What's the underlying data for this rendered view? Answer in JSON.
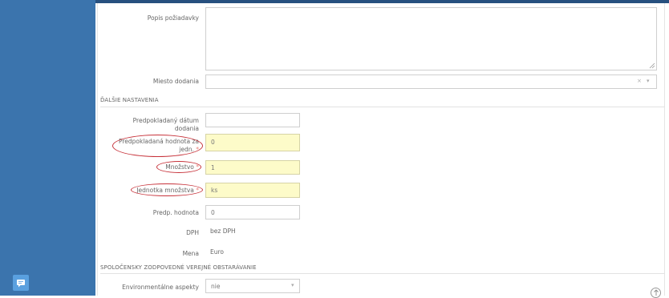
{
  "form": {
    "popis_label": "Popis požiadavky",
    "miesto_label": "Miesto dodania",
    "miesto_clear": "×",
    "miesto_arrow": "▾",
    "section_dalsie": "ĎALŠIE NASTAVENIA",
    "datum_label": "Predpokladaný dátum dodania",
    "hodnota_jedn_label_1": "Predpokladaná hodnota za",
    "hodnota_jedn_label_2": "jedn.",
    "hodnota_jedn_value": "0",
    "mnozstvo_label": "Množstvo",
    "mnozstvo_value": "1",
    "jednotka_label": "Jednotka množstva",
    "jednotka_value": "ks",
    "predp_hodnota_label": "Predp. hodnota",
    "predp_hodnota_value": "0",
    "dph_label": "DPH",
    "dph_value": "bez DPH",
    "mena_label": "Mena",
    "mena_value": "Euro",
    "required_mark": "*",
    "section_spolocensky": "SPOLOČENSKY ZODPOVEDNÉ VEREJNÉ OBSTARÁVANIE",
    "env_label": "Environmentálne aspekty",
    "env_value": "nie",
    "env_arrow": "▾"
  },
  "colors": {
    "sidebar": "#3b74ad",
    "highlight_field": "#fdfbc9",
    "annotation_oval": "#c7323a",
    "chat_button": "#5aa0df"
  },
  "icons": {
    "chat": "chat-icon",
    "scroll_top": "arrow-up-circle-icon",
    "resize": "resize-handle-icon"
  }
}
